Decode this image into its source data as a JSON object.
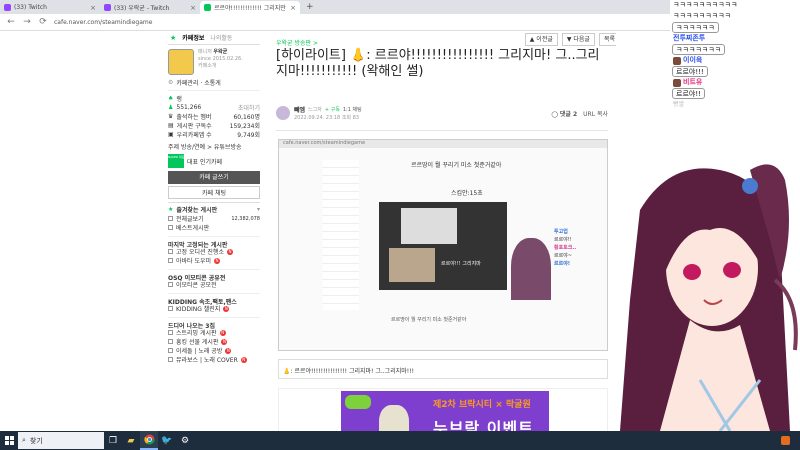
{
  "browser": {
    "tabs": [
      {
        "title": "(33) Twitch",
        "active": false
      },
      {
        "title": "(33) 우락균 - Twitch",
        "active": false
      },
      {
        "title": "르르야!!!!!!!!!!!!! 그리지만",
        "active": true
      }
    ],
    "new_tab_label": "+",
    "url": "cafe.naver.com/steamindiegame"
  },
  "sidebar": {
    "tabs": [
      "카페정보",
      "나의활동"
    ],
    "manager_label": "매니저",
    "manager_name": "우왁굳",
    "since": "since 2015.02.26.",
    "cafe_intro": "카페소개",
    "cafe_manage": "카페관리 · 소통게",
    "level": "랭",
    "members": "551,266",
    "invite": "초대하기",
    "stats": [
      {
        "label": "출석하는 멤버",
        "value": "60,160명"
      },
      {
        "label": "게시판 구독수",
        "value": "159,234회"
      },
      {
        "label": "우리카페앱 수",
        "value": "9,749회"
      }
    ],
    "topic": "주제 방송/연예 > 유튜브방송",
    "rank_badge": "NAVER 대표카페",
    "rank_text": "대표 인기카페",
    "write_button": "카페 글쓰기",
    "chat_button": "카페 채팅",
    "favorites_title": "즐겨찾는 게시판",
    "all_posts": "전체글보기",
    "all_posts_count": "12,382,078",
    "best_posts": "베스트게시판",
    "sections": [
      {
        "title": "마지막 고정되는 게시판",
        "items": [
          "고정 오디션 진행소",
          "아바타 도우미"
        ]
      },
      {
        "title": "OSQ 이모티콘 공유전",
        "items": [
          "이모티콘 공모전"
        ]
      },
      {
        "title": "KIDDING 속조,팩토,팬스",
        "items": [
          "KIDDING 챌린지"
        ]
      },
      {
        "title": "드디어 나오는 3집",
        "items": [
          "스트리밍 게시판",
          "흥킹 선물 게시판",
          "이세돌 | 노래 공방",
          "뮤라보스 | 노래 COVER"
        ]
      }
    ]
  },
  "article": {
    "top_buttons": [
      "이전글",
      "다음글",
      "목록"
    ],
    "board": "우왁굳 방송판 >",
    "title": "[하이라이트] 👃: 르르야!!!!!!!!!!!!!!!! 그리지마! 그..그리지마!!!!!!!!!!! (왁해인 썰)",
    "author": "빼엠",
    "author_tag": "느그자",
    "subscribe": "+ 구독",
    "chat_label": "1:1 채팅",
    "datetime": "2022.09.24. 23:18",
    "views": "조회 83",
    "comments": "댓글 2",
    "url_copy": "URL 복사",
    "embedded": {
      "bar": "cafe.naver.com/steamindiegame",
      "post_title": "르르땅이 뭘 꾸리기 미소 첫준거같아",
      "timestamp": "스킵안:15초",
      "video_text": "르르야!!! 그리지마",
      "chat_lines": [
        "투고업",
        "르르야!!",
        "황포토크..",
        "르르야~",
        "르르야!"
      ],
      "footer": "르르땅이 뭘 꾸리기 미소 첫준거같아"
    },
    "caption": "👃: 르르야!!!!!!!!!!!!!!! 그리지마! 그..그리지마!!!",
    "banner": {
      "line1": "제2차 브락시티 × 락굴원",
      "line2": "누브락 이벤트"
    }
  },
  "chat": {
    "lines": [
      {
        "type": "text",
        "text": "ㅋㅋㅋㅋㅋㅋㅋㅋㅋㅋ"
      },
      {
        "type": "text",
        "text": "ㅋㅋㅋㅋㅋㅋㅋㅋㅋ"
      },
      {
        "type": "bubble",
        "text": "ㅋㅋㅋㅋㅋㅋ"
      },
      {
        "type": "name",
        "name": "전투찌존투",
        "color": "blue"
      },
      {
        "type": "bubble",
        "text": "ㅋㅋㅋㅋㅋㅋㅋ"
      },
      {
        "type": "name",
        "name": "이이육",
        "color": "blue"
      },
      {
        "type": "bubble",
        "text": "르르야!!!"
      },
      {
        "type": "name",
        "name": "비트유",
        "color": "pink"
      },
      {
        "type": "bubble",
        "text": "르르야!!"
      },
      {
        "type": "pale",
        "text": "빵쌀"
      }
    ]
  },
  "taskbar": {
    "search_placeholder": "찾기",
    "icons": [
      "task-view",
      "file-explorer",
      "chrome",
      "twitter",
      "steam"
    ]
  }
}
